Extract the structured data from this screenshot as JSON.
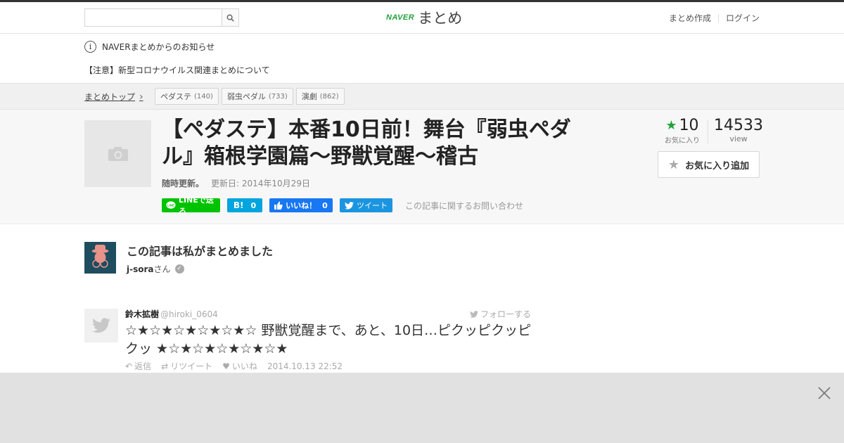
{
  "header": {
    "search_placeholder": "",
    "logo_naver": "NAVER",
    "logo_matome": "まとめ",
    "links": [
      "まとめ作成",
      "ログイン"
    ]
  },
  "notice": {
    "heading": "NAVERまとめからのお知らせ",
    "link": "【注意】新型コロナウイルス関連まとめについて"
  },
  "breadcrumb": {
    "top_label": "まとめトップ",
    "tags": [
      {
        "label": "ペダステ",
        "count": "(140)"
      },
      {
        "label": "弱虫ペダル",
        "count": "(733)"
      },
      {
        "label": "演劇",
        "count": "(862)"
      }
    ]
  },
  "article": {
    "title": "【ペダステ】本番10日前！舞台『弱虫ペダル』箱根学園篇～野獣覚醒～稽古",
    "update_note": "随時更新。",
    "updated": "更新日: 2014年10月29日",
    "share": {
      "line": "LINEで送る",
      "hatena_count": "0",
      "fb_label": "いいね！",
      "fb_count": "0",
      "tweet": "ツイート"
    },
    "contact": "この記事に関するお問い合わせ",
    "favorites": {
      "count": "10",
      "label": "お気に入り"
    },
    "views": {
      "count": "14533",
      "label": "view"
    },
    "fav_button": "お気に入り追加"
  },
  "author": {
    "title": "この記事は私がまとめました",
    "name": "j-sora",
    "suffix": "さん"
  },
  "tweet": {
    "name": "鈴木拡樹",
    "handle": "@hiroki_0604",
    "follow": "フォローする",
    "text": "☆★☆★☆★☆★☆★☆ 野獣覚醒まで、あと、10日…ピクッピクッピクッ ★☆★☆★☆★☆★☆★",
    "reply": "返信",
    "retweet": "リツイート",
    "like": "いいね",
    "time": "2014.10.13 22:52"
  },
  "colors": {
    "brand_green": "#21a33b",
    "line": "#00c300",
    "hatena": "#00a4de",
    "facebook": "#1877f2",
    "twitter": "#1b95e0"
  }
}
